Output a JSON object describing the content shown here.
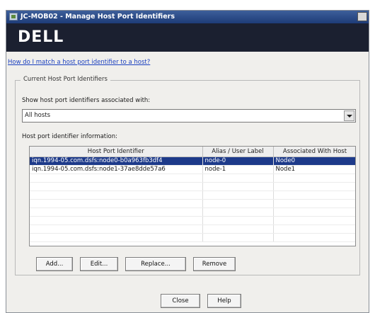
{
  "window": {
    "title": "JC-MOB02 - Manage Host Port Identifiers"
  },
  "brand": {
    "logo_text": "DELL"
  },
  "help_link": "How do I match a host port identifier to a host?",
  "group": {
    "title": "Current Host Port Identifiers"
  },
  "show": {
    "label": "Show host port identifiers associated with:",
    "selected": "All hosts"
  },
  "info": {
    "label": "Host port identifier information:"
  },
  "table": {
    "columns": [
      "Host Port Identifier",
      "Alias / User Label",
      "Associated With Host"
    ],
    "rows": [
      {
        "identifier": "iqn.1994-05.com.dsfs:node0-b0a963fb3df4",
        "alias": "node-0",
        "host": "Node0",
        "selected": true
      },
      {
        "identifier": "iqn.1994-05.com.dsfs:node1-37ae8dde57a6",
        "alias": "node-1",
        "host": "Node1",
        "selected": false
      }
    ]
  },
  "buttons": {
    "add": "Add...",
    "edit": "Edit...",
    "replace": "Replace...",
    "remove": "Remove",
    "close": "Close",
    "help": "Help"
  }
}
